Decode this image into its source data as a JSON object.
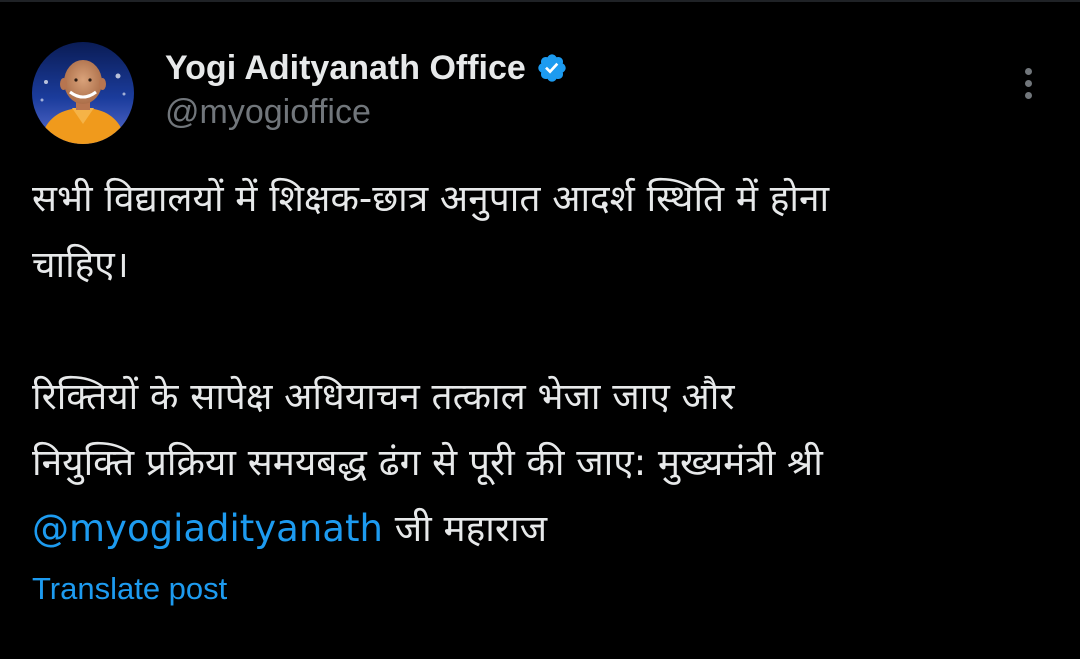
{
  "post": {
    "author": {
      "name": "Yogi Adityanath Office",
      "handle": "@myogioffice",
      "verified": true,
      "avatar_icon": "profile-photo"
    },
    "more_icon": "more-vertical-icon",
    "body": {
      "paragraph1_line1": "सभी विद्यालयों में शिक्षक-छात्र अनुपात आदर्श स्थिति में होना",
      "paragraph1_line2": "चाहिए।",
      "paragraph2_line1": "रिक्तियों के सापेक्ष अधियाचन तत्काल भेजा जाए और",
      "paragraph2_line2": "नियुक्ति प्रक्रिया समयबद्ध ढंग से पूरी की जाए: मुख्यमंत्री श्री",
      "mention": "@myogiadityanath",
      "paragraph2_line3_rest": " जी महाराज"
    },
    "translate_label": "Translate post"
  },
  "colors": {
    "background": "#000000",
    "text_primary": "#e7e9ea",
    "text_secondary": "#71767b",
    "accent": "#1d9bf0"
  }
}
